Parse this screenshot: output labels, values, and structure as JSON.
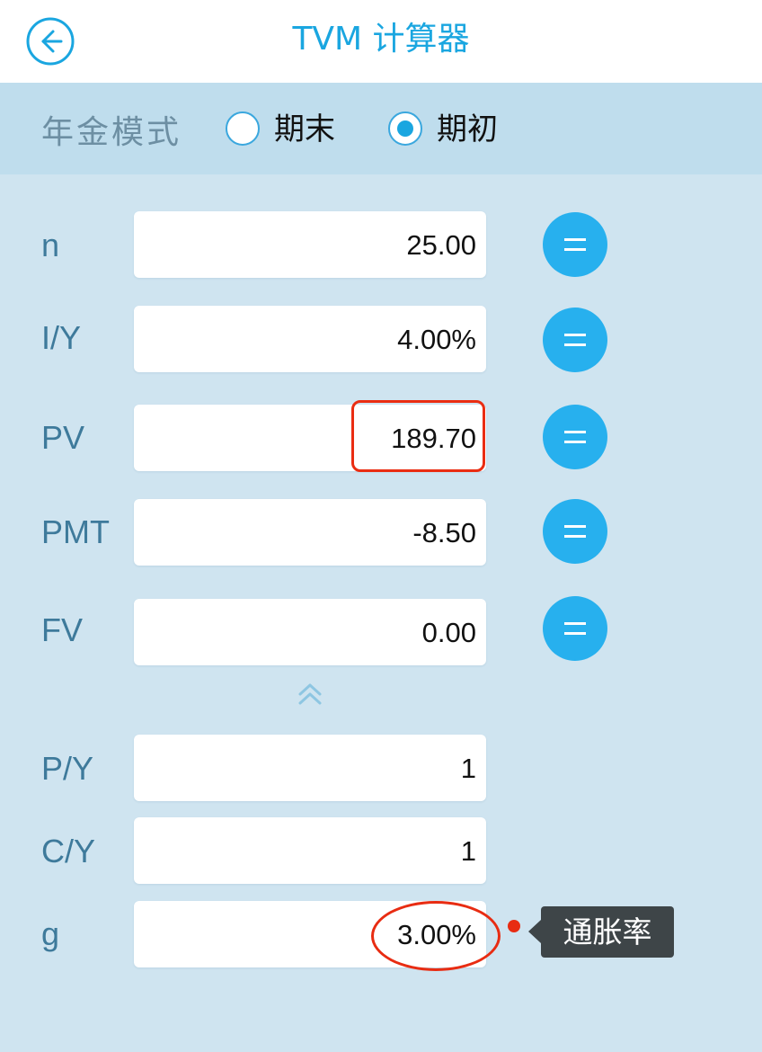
{
  "header": {
    "title": "TVM 计算器",
    "back_icon": "back-arrow-circle-icon"
  },
  "mode": {
    "label": "年金模式",
    "options": [
      {
        "label": "期末",
        "selected": false
      },
      {
        "label": "期初",
        "selected": true
      }
    ]
  },
  "fields": [
    {
      "label": "n",
      "value": "25.00",
      "has_solve": true
    },
    {
      "label": "I/Y",
      "value": "4.00%",
      "has_solve": true
    },
    {
      "label": "PV",
      "value": "189.70",
      "has_solve": true,
      "highlighted": true
    },
    {
      "label": "PMT",
      "value": "-8.50",
      "has_solve": true
    },
    {
      "label": "FV",
      "value": "0.00",
      "has_solve": true
    }
  ],
  "collapse_icon": "double-chevron-up-icon",
  "extra_fields": [
    {
      "label": "P/Y",
      "value": "1"
    },
    {
      "label": "C/Y",
      "value": "1"
    },
    {
      "label": "g",
      "value": "3.00%",
      "highlighted": true
    }
  ],
  "annotation": {
    "tooltip": "通胀率"
  },
  "colors": {
    "accent": "#1aa6e0",
    "button": "#27b0ee",
    "background": "#cfe4f0",
    "mode_bar": "#bfdded",
    "highlight": "#e82c12",
    "tooltip_bg": "#3e4548"
  }
}
